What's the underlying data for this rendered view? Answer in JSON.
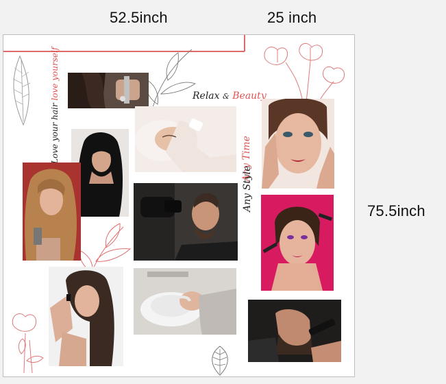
{
  "dimensions": {
    "width_left": "52.5inch",
    "width_right": "25 inch",
    "height": "75.5inch"
  },
  "texts": {
    "relax": "Relax",
    "amp": "&",
    "beauty": "Beauty",
    "love_hair": "Love your hair",
    "love_yourself": "love yourself",
    "any_time": "Any Time",
    "any_style": "Any Style"
  },
  "colors": {
    "accent_red": "#e05555",
    "dark_text": "#222222",
    "magenta_bg": "#d81b60"
  }
}
